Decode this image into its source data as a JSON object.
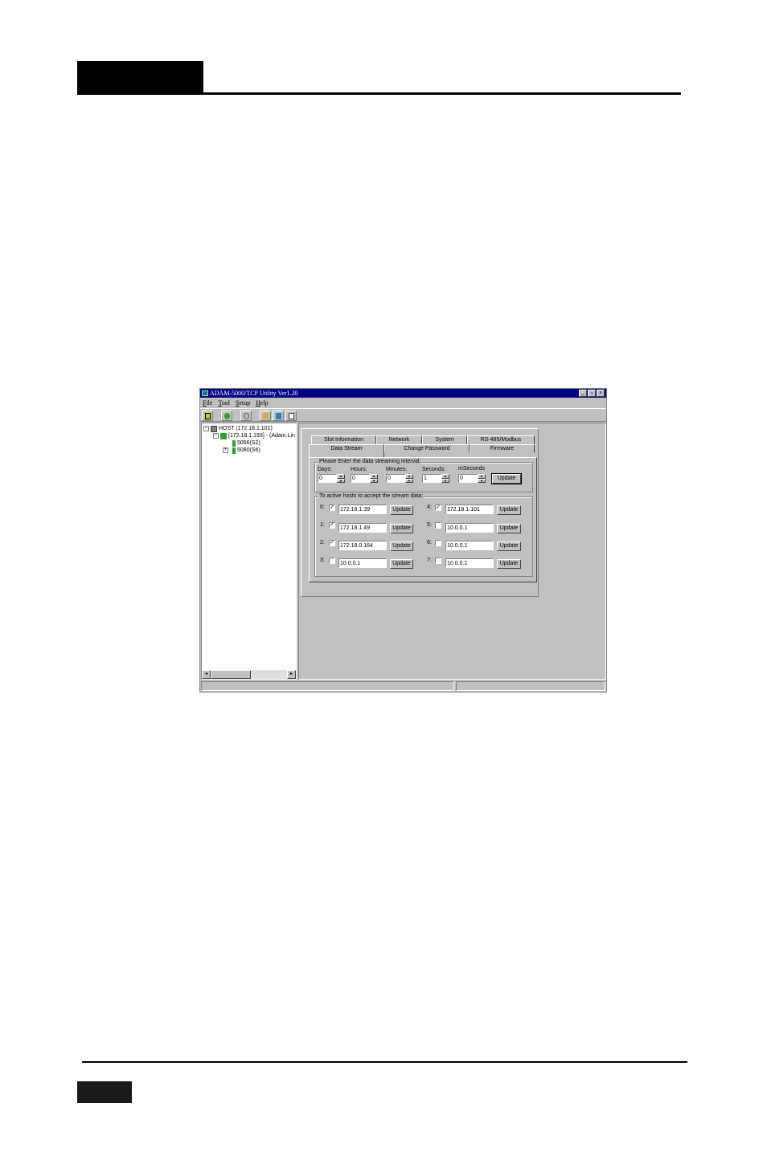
{
  "window": {
    "title": "ADAM-5000/TCP Utility Ver1.20",
    "controls": [
      "_",
      "▫",
      "×"
    ]
  },
  "menu": [
    "File",
    "Tool",
    "Setup",
    "Help"
  ],
  "tree": {
    "host": "HOST (172.18.1.101)",
    "device": "[172.18.1.193] - (Adam.Lin",
    "modules": [
      "5056(S2)",
      "5080(S6)"
    ],
    "collapse_glyph": "−",
    "expand_glyph": "+"
  },
  "tabs": {
    "row_back": [
      "Slot Information",
      "Network",
      "System",
      "RS-485/Modbus"
    ],
    "row_front": [
      "Data Stream",
      "Change Password",
      "Firmware"
    ]
  },
  "interval": {
    "group_label": "Please Enter the data streaming interval:",
    "fields": [
      {
        "label": "Days:",
        "value": "0"
      },
      {
        "label": "Hours:",
        "value": "0"
      },
      {
        "label": "Minutes:",
        "value": "0"
      },
      {
        "label": "Seconds:",
        "value": "1"
      },
      {
        "label": "mSeconds",
        "value": "0"
      }
    ],
    "update_label": "Update"
  },
  "hosts": {
    "group_label": "To active hosts to accept  the stream data:",
    "update_label": "Update",
    "check_glyph": "✓",
    "items": [
      {
        "index": "0:",
        "checked": true,
        "ip": "172.18.1.39"
      },
      {
        "index": "1:",
        "checked": true,
        "ip": "172.18.1.49"
      },
      {
        "index": "2:",
        "checked": true,
        "ip": "172.18.0.164"
      },
      {
        "index": "3:",
        "checked": false,
        "ip": "10.0.0.1"
      },
      {
        "index": "4:",
        "checked": true,
        "ip": "172.18.1.101"
      },
      {
        "index": "5:",
        "checked": false,
        "ip": "10.0.0.1"
      },
      {
        "index": "6:",
        "checked": false,
        "ip": "10.0.0.1"
      },
      {
        "index": "7:",
        "checked": false,
        "ip": "10.0.0.1"
      }
    ]
  },
  "scroll": {
    "left": "◂",
    "right": "▸"
  },
  "spin": {
    "up": "▲",
    "down": "▼"
  },
  "colors": {
    "titlebar": "#000080",
    "face": "#c0c0c0"
  }
}
